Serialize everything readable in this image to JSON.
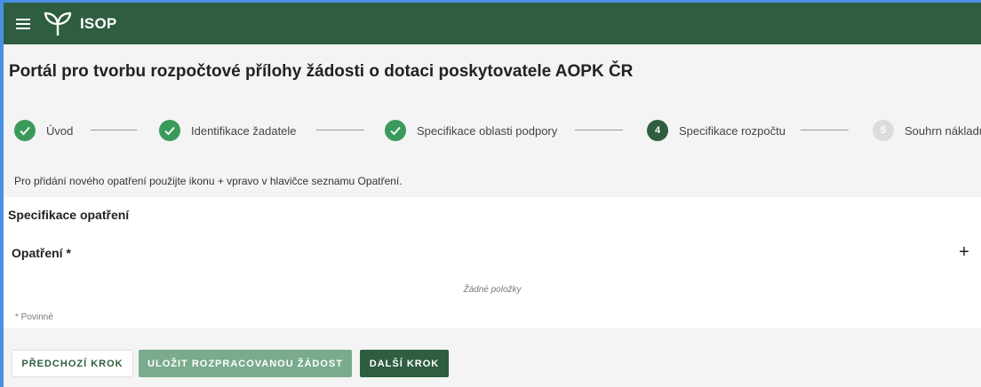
{
  "app": {
    "name": "ISOP"
  },
  "page": {
    "title": "Portál pro tvorbu rozpočtové přílohy žádosti o dotaci poskytovatele AOPK ČR",
    "hint": "Pro přidání nového opatření použijte ikonu + vpravo v hlavičce seznamu Opatření."
  },
  "stepper": {
    "steps": [
      {
        "label": "Úvod",
        "status": "done",
        "number": ""
      },
      {
        "label": "Identifikace žadatele",
        "status": "done",
        "number": ""
      },
      {
        "label": "Specifikace oblasti podpory",
        "status": "done",
        "number": ""
      },
      {
        "label": "Specifikace rozpočtu",
        "status": "active",
        "number": "4"
      },
      {
        "label": "Souhrn nákladů",
        "status": "inactive",
        "number": "5"
      }
    ]
  },
  "section": {
    "title": "Specifikace opatření",
    "list_title": "Opatření *",
    "add_icon": "+",
    "empty_text": "Žádné položky",
    "required_note": "* Povinné"
  },
  "buttons": {
    "prev": "PŘEDCHOZÍ KROK",
    "save": "ULOŽIT ROZPRACOVANOU ŽÁDOST",
    "next": "DALŠÍ KROK"
  },
  "colors": {
    "appbar": "#2e5e3f",
    "step_done": "#3a9a5b",
    "step_active": "#2e5e3f",
    "step_inactive": "#dcdcdc",
    "save_button": "#7aab8c"
  }
}
